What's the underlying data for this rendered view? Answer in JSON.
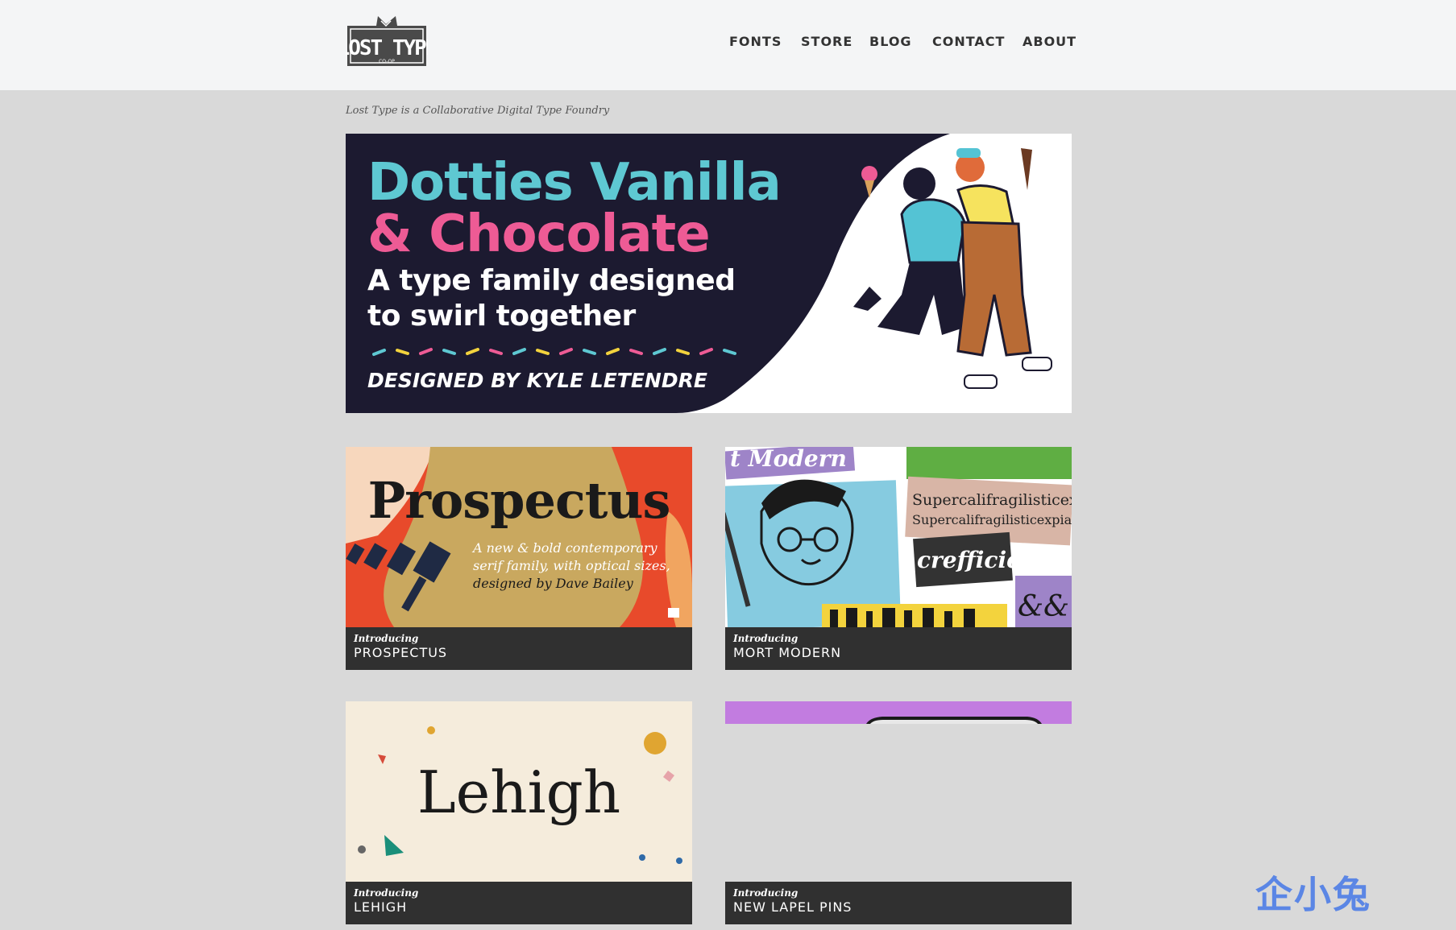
{
  "header": {
    "logo_text": "LOST TYPE",
    "logo_sub": "CO-OP",
    "nav": [
      {
        "label": "FONTS"
      },
      {
        "label": "STORE"
      },
      {
        "label": "BLOG"
      },
      {
        "label": "CONTACT"
      },
      {
        "label": "ABOUT"
      }
    ]
  },
  "tagline": "Lost Type is a Collaborative Digital Type Foundry",
  "hero": {
    "line1": "Dotties Vanilla",
    "line2": "& Chocolate",
    "line3": "A type family designed",
    "line4": "to swirl together",
    "credit": "DESIGNED BY KYLE LETENDRE"
  },
  "cards": [
    {
      "intro": "Introducing",
      "title": "PROSPECTUS",
      "art_title": "Prospectus",
      "art_sub": [
        "A new & bold contemporary",
        "serif family, with optical sizes,",
        "designed by Dave Bailey"
      ]
    },
    {
      "intro": "Introducing",
      "title": "MORT MODERN",
      "art_texts": [
        "t Modern",
        "Supercalifragilisticexp",
        "Supercalifragilisticexpialidoci",
        "crefficie",
        "&&"
      ]
    },
    {
      "intro": "Introducing",
      "title": "LEHIGH",
      "art_title": "Lehigh"
    },
    {
      "intro": "Introducing",
      "title": "NEW LAPEL PINS"
    }
  ],
  "watermark": "企小兔",
  "colors": {
    "page_bg": "#d9d9d9",
    "header_bg": "#f4f5f6",
    "hero_bg": "#1c1a30",
    "hero_cyan": "#5ec8d2",
    "hero_pink": "#ee5b95",
    "caption_bg": "#303030"
  }
}
